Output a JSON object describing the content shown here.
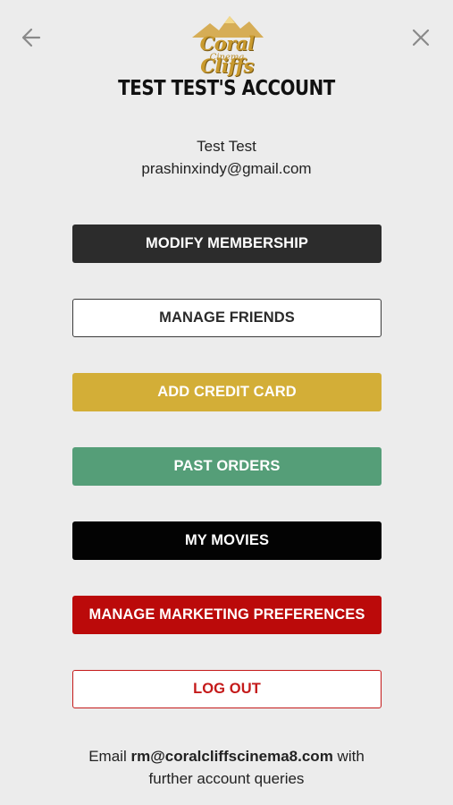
{
  "header": {
    "back_icon": "arrow-left-icon",
    "close_icon": "close-icon",
    "logo_text": "Coral Cliffs",
    "logo_sub": "Cinema",
    "title": "TEST TEST'S ACCOUNT"
  },
  "user": {
    "name": "Test Test",
    "email": "prashinxindy@gmail.com"
  },
  "buttons": {
    "modify_membership": "MODIFY MEMBERSHIP",
    "manage_friends": "MANAGE FRIENDS",
    "add_credit_card": "ADD CREDIT CARD",
    "past_orders": "PAST ORDERS",
    "my_movies": "MY MOVIES",
    "manage_marketing": "MANAGE MARKETING PREFERENCES",
    "log_out": "LOG OUT"
  },
  "colors": {
    "background": "#ececec",
    "modify": "#2c2c2c",
    "gold": "#d3ae37",
    "green": "#559e78",
    "black": "#030303",
    "red": "#bb0a0a"
  },
  "footer": {
    "prefix": "Email",
    "email": "rm@coralcliffscinema8.com",
    "suffix": "with",
    "line2": "further account queries"
  }
}
